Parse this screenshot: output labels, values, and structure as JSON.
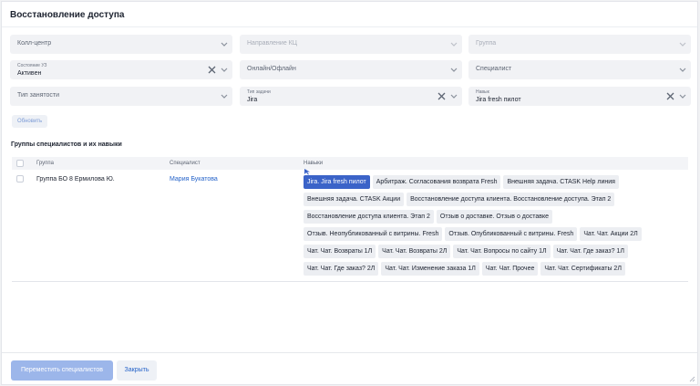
{
  "dialog": {
    "title": "Восстановление доступа"
  },
  "filters": {
    "call_center": {
      "placeholder": "Колл-центр"
    },
    "direction": {
      "placeholder": "Направление КЦ"
    },
    "group": {
      "placeholder": "Группа"
    },
    "account_state": {
      "label": "Состояние УЗ",
      "value": "Активен"
    },
    "online_offline": {
      "placeholder": "Онлайн/Офлайн"
    },
    "specialist": {
      "placeholder": "Специалист"
    },
    "employment_type": {
      "placeholder": "Тип занятости"
    },
    "task_type": {
      "label": "Тип задачи",
      "value": "Jira"
    },
    "skills": {
      "label": "Навык",
      "value": "Jira fresh пилот"
    },
    "refresh_label": "Обновить"
  },
  "groups_section": {
    "title": "Группы специалистов и их навыки",
    "columns": {
      "group": "Группа",
      "specialist": "Специалист",
      "skills": "Навыки"
    },
    "rows": [
      {
        "group": "Группа БО 8 Ермилова Ю.",
        "specialist": "Мария Букатова",
        "skills": [
          [
            "Jira. Jira fresh пилот",
            "Арбитраж. Согласования возврата Fresh",
            "Внешняя задача. CTASK Help линия"
          ],
          [
            "Внешняя задача. CTASK Акции",
            "Восстановление доступа клиента. Восстановление доступа. Этап 2"
          ],
          [
            "Восстановление доступа клиента. Этап 2",
            "Отзыв о доставке. Отзыв о доставке"
          ],
          [
            "Отзыв. Неопубликованный с витрины. Fresh",
            "Отзыв. Опубликованный с витрины. Fresh",
            "Чат. Чат. Акции 2Л"
          ],
          [
            "Чат. Чат. Возвраты 1Л",
            "Чат. Чат. Возвраты 2Л",
            "Чат. Чат. Вопросы по сайту 1Л",
            "Чат. Чат. Где заказ? 1Л"
          ],
          [
            "Чат. Чат. Где заказ? 2Л",
            "Чат. Чат. Изменение заказа 1Л",
            "Чат. Чат. Прочее",
            "Чат. Чат. Сертификаты 2Л"
          ]
        ],
        "selected_skill": "Jira. Jira fresh пилот"
      }
    ]
  },
  "footer": {
    "move_label": "Переместить специалистов",
    "close_label": "Закрыть"
  },
  "colors": {
    "accent": "#3b63c8",
    "link": "#2563c9",
    "primary_button": "#9cb6ea",
    "field_bg": "#f1f2f5"
  }
}
